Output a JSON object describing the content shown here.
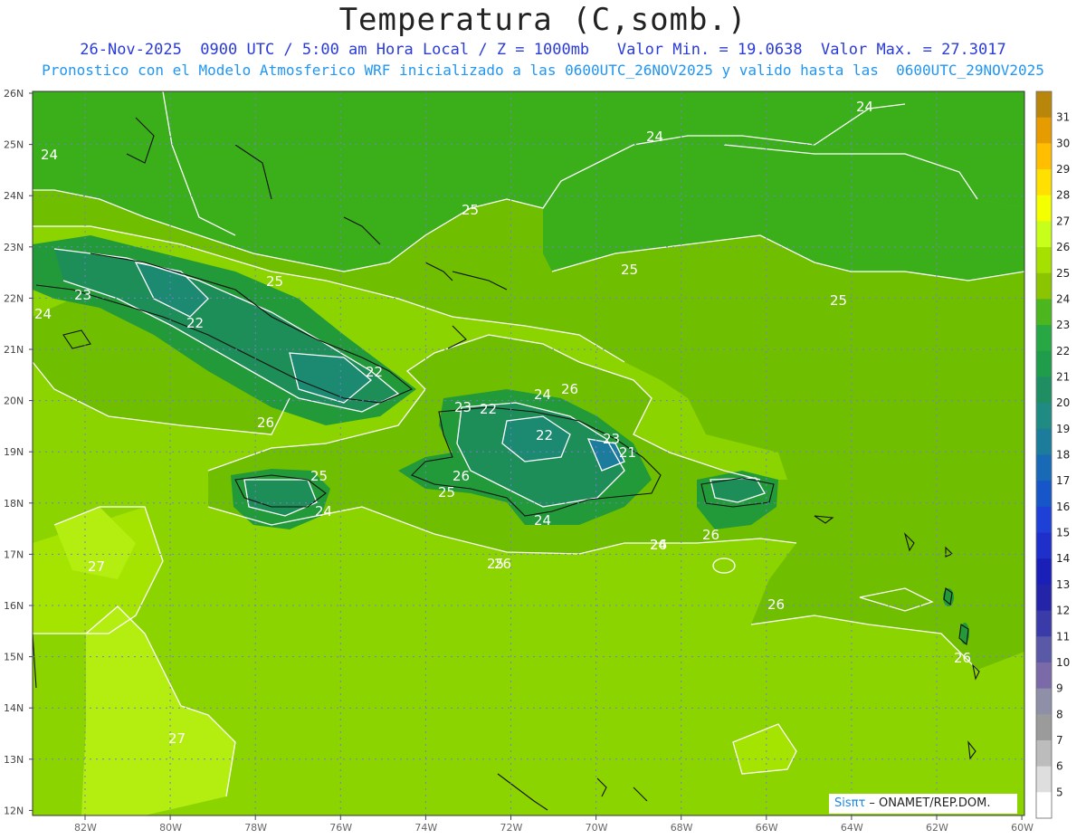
{
  "header": {
    "title": "Temperatura (C,somb.)",
    "line1": "26-Nov-2025  0900 UTC / 5:00 am Hora Local / Z = 1000mb   Valor Min. = 19.0638  Valor Max. = 27.3017",
    "line2": "Pronostico con el Modelo Atmosferico WRF inicializado a las 0600UTC_26NOV2025 y valido hasta las  0600UTC_29NOV2025"
  },
  "axes": {
    "lat_labels": [
      "26N",
      "25N",
      "24N",
      "23N",
      "22N",
      "21N",
      "20N",
      "19N",
      "18N",
      "17N",
      "16N",
      "15N",
      "14N",
      "13N",
      "12N"
    ],
    "lon_labels": [
      "82W",
      "80W",
      "78W",
      "76W",
      "74W",
      "72W",
      "70W",
      "68W",
      "66W",
      "64W",
      "62W",
      "60W"
    ]
  },
  "contour_labels": [
    "24",
    "24",
    "24",
    "25",
    "25",
    "25",
    "25",
    "23",
    "24",
    "22",
    "22",
    "26",
    "22",
    "23",
    "22",
    "24",
    "26",
    "23",
    "21",
    "25",
    "26",
    "24",
    "25",
    "24",
    "24",
    "26",
    "25",
    "26",
    "26",
    "27",
    "26",
    "26",
    "27"
  ],
  "colorbar": {
    "levels": [
      "31",
      "30",
      "29",
      "28",
      "27",
      "26",
      "25",
      "24",
      "23",
      "22",
      "21",
      "20",
      "19",
      "18",
      "17",
      "16",
      "15",
      "14",
      "13",
      "12",
      "11",
      "10",
      "9",
      "8",
      "7",
      "6",
      "5"
    ],
    "colors": [
      "#b8860b",
      "#e69b00",
      "#ffbf00",
      "#ffe000",
      "#f4ff00",
      "#c8ff1a",
      "#a6e000",
      "#8bc400",
      "#4cb61f",
      "#28a745",
      "#1f9d4b",
      "#1f8f63",
      "#1f8b82",
      "#1b7c9c",
      "#1869b6",
      "#1756c8",
      "#1e40d6",
      "#1f2fc9",
      "#1a1fb8",
      "#2424a8",
      "#3a3aa8",
      "#5959a8",
      "#7a6aa8",
      "#8f8fa8",
      "#9b9b9b",
      "#bcbcbc",
      "#dedede",
      "#ffffff"
    ]
  },
  "credit": {
    "brand": "Sisπτ",
    "text": " –  ONAMET/REP.DOM."
  }
}
